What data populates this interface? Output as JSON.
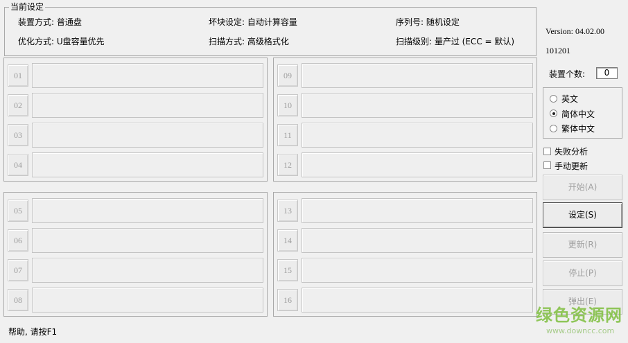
{
  "current_settings": {
    "title": "当前设定",
    "mount_mode": "装置方式: 普通盘",
    "bad_block": "坏块设定: 自动计算容量",
    "serial": "序列号: 随机设定",
    "optimize": "优化方式: U盘容量优先",
    "scan_mode": "扫描方式: 高级格式化",
    "scan_level": "扫描级别: 量产过 (ECC = 默认)"
  },
  "version": {
    "line1": "Version: 04.02.00",
    "line2": "101201"
  },
  "device_count": {
    "label": "装置个数:",
    "value": "0"
  },
  "language": {
    "options": [
      "英文",
      "简体中文",
      "繁体中文"
    ],
    "selected": "简体中文"
  },
  "options": {
    "fail_analysis": "失败分析",
    "manual_update": "手动更新"
  },
  "buttons": {
    "start": "开始(A)",
    "settings": "设定(S)",
    "update": "更新(R)",
    "stop": "停止(P)",
    "eject": "弹出(E)"
  },
  "slots": [
    "01",
    "02",
    "03",
    "04",
    "05",
    "06",
    "07",
    "08",
    "09",
    "10",
    "11",
    "12",
    "13",
    "14",
    "15",
    "16"
  ],
  "status_bar": "帮助, 请按F1",
  "watermark": {
    "title": "绿色资源网",
    "url": "www.downcc.com"
  }
}
